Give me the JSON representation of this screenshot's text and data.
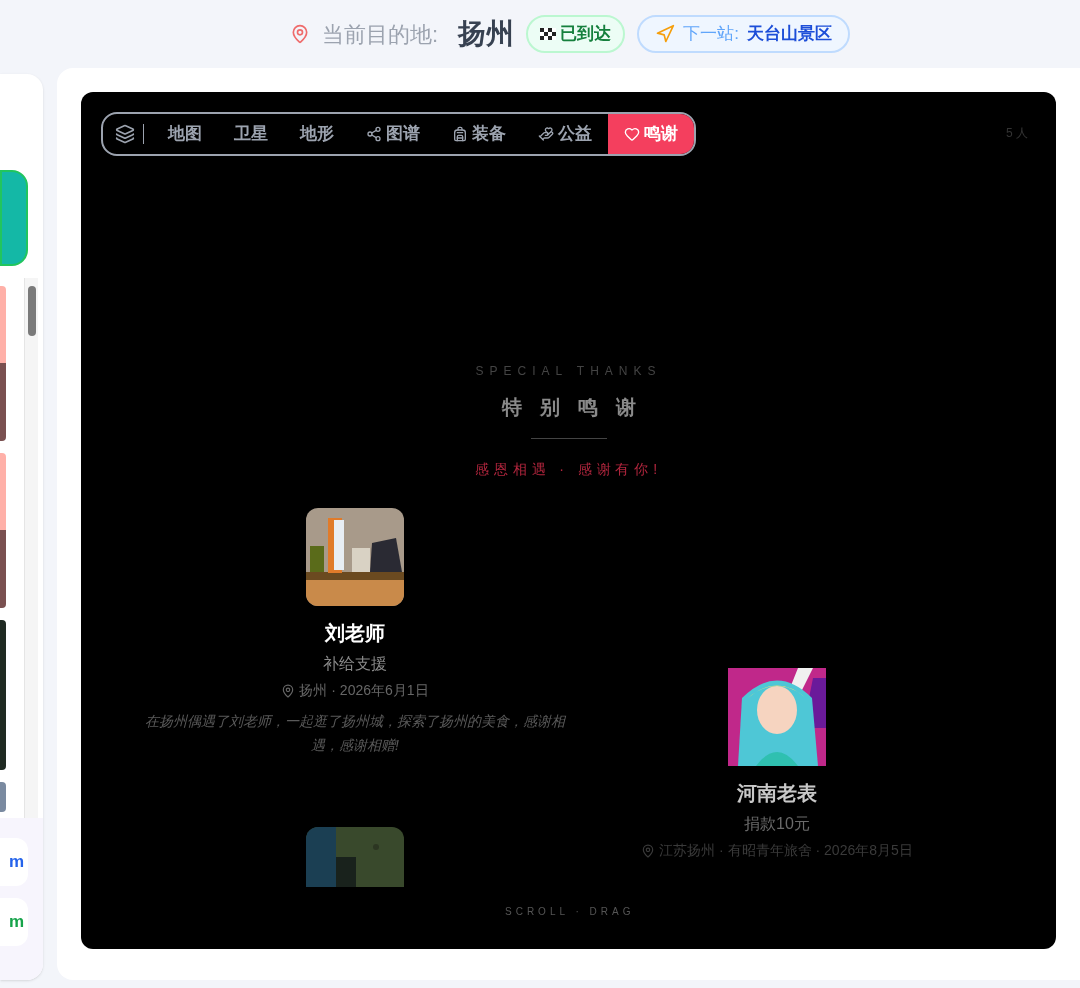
{
  "header": {
    "label": "当前目的地:",
    "city": "扬州",
    "status": "已到达",
    "next_label": "下一站:",
    "next_value": "天台山景区"
  },
  "sidebar": {
    "links": [
      {
        "text": "m",
        "color": "#2563eb"
      },
      {
        "text": "m",
        "color": "#16a34a"
      }
    ]
  },
  "toolbar": {
    "tabs": [
      {
        "label": "地图",
        "selected": false
      },
      {
        "label": "卫星",
        "selected": false
      },
      {
        "label": "地形",
        "selected": false
      },
      {
        "label": "图谱",
        "selected": false
      },
      {
        "label": "装备",
        "selected": false
      },
      {
        "label": "公益",
        "selected": false
      },
      {
        "label": "鸣谢",
        "selected": true
      }
    ]
  },
  "count": "5 人",
  "credits": {
    "eyebrow": "SPECIAL THANKS",
    "title": "特别鸣谢",
    "subtitle": "感恩相遇 · 感谢有你!",
    "hint": "SCROLL · DRAG",
    "cards": [
      {
        "name": "刘老师",
        "role": "补给支援",
        "meta": "扬州 · 2026年6月1日",
        "note": "在扬州偶遇了刘老师，一起逛了扬州城，探索了扬州的美食，感谢相遇，感谢相赠!"
      },
      {
        "name": "河南老表",
        "role": "捐款10元",
        "meta": "江苏扬州 · 有昭青年旅舍 · 2026年8月5日"
      }
    ]
  }
}
